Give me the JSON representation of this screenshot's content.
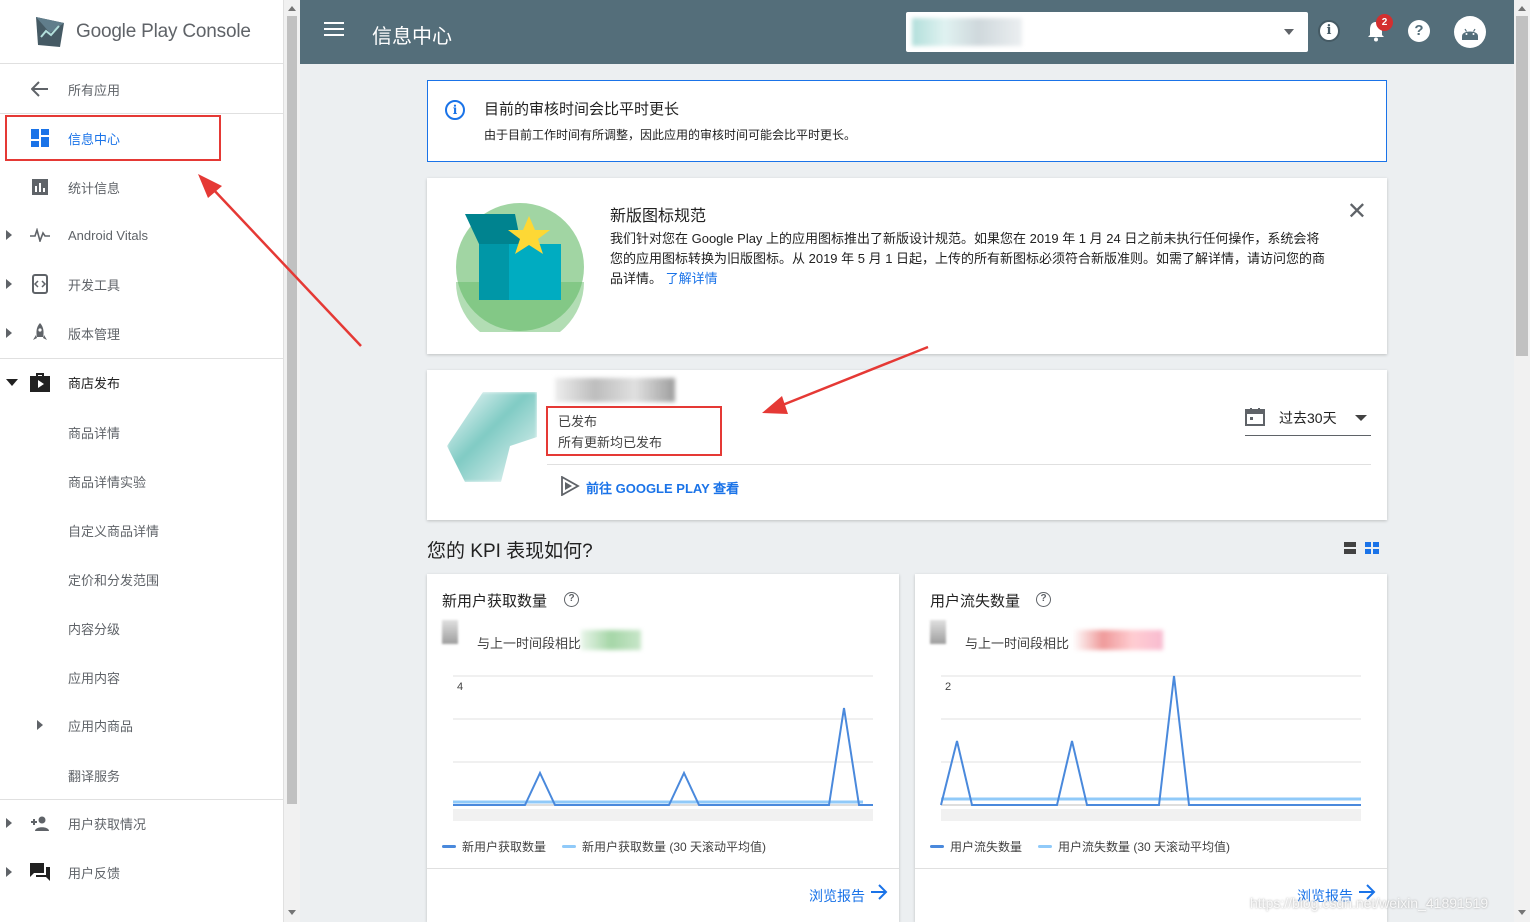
{
  "brand": {
    "name_a": "Google Play",
    "name_b": "Console"
  },
  "sidebar": {
    "items": [
      {
        "label": "所有应用"
      },
      {
        "label": "信息中心"
      },
      {
        "label": "统计信息"
      },
      {
        "label": "Android Vitals"
      },
      {
        "label": "开发工具"
      },
      {
        "label": "版本管理"
      },
      {
        "label": "商店发布"
      },
      {
        "label": "商品详情"
      },
      {
        "label": "商品详情实验"
      },
      {
        "label": "自定义商品详情"
      },
      {
        "label": "定价和分发范围"
      },
      {
        "label": "内容分级"
      },
      {
        "label": "应用内容"
      },
      {
        "label": "应用内商品"
      },
      {
        "label": "翻译服务"
      },
      {
        "label": "用户获取情况"
      },
      {
        "label": "用户反馈"
      }
    ]
  },
  "topbar": {
    "title": "信息中心",
    "notification_count": "2",
    "info_glyph": "i",
    "help_glyph": "?"
  },
  "alert": {
    "title": "目前的审核时间会比平时更长",
    "body": "由于目前工作时间有所调整，因此应用的审核时间可能会比平时更长。",
    "glyph": "i"
  },
  "icon_notice": {
    "title": "新版图标规范",
    "body": "我们针对您在 Google Play 上的应用图标推出了新版设计规范。如果您在 2019 年 1 月 24 日之前未执行任何操作，系统会将您的应用图标转换为旧版图标。从 2019 年 5 月 1 日起，上传的所有新图标必须符合新版准则。如需了解详情，请访问您的商品详情。",
    "link": "了解详情",
    "close_glyph": "✕"
  },
  "app_status": {
    "status": "已发布",
    "substatus": "所有更新均已发布",
    "play_link": "前往 GOOGLE PLAY 查看",
    "date_range": "过去30天"
  },
  "kpi_heading": "您的 KPI 表现如何?",
  "kpis": [
    {
      "title": "新用户获取数量",
      "compare_label": "与上一时间段相比",
      "legend_a": "新用户获取数量",
      "legend_b": "新用户获取数量 (30 天滚动平均值)",
      "report_link": "浏览报告",
      "y_tick": "4"
    },
    {
      "title": "用户流失数量",
      "compare_label": "与上一时间段相比",
      "legend_a": "用户流失数量",
      "legend_b": "用户流失数量 (30 天滚动平均值)",
      "report_link": "浏览报告",
      "y_tick": "2"
    }
  ],
  "watermark": "https://blog.csdn.net/weixin_41891519",
  "colors": {
    "topbar": "#546e7a",
    "accent": "#1a73e8",
    "annotation_red": "#e53935",
    "series_main": "#4a89dc",
    "series_avg": "#90caf9"
  },
  "icons": [
    "menu-icon",
    "info-icon",
    "bell-icon",
    "help-icon",
    "android-avatar-icon",
    "arrow-back-icon",
    "dashboard-icon",
    "bar-chart-icon",
    "vitals-icon",
    "dev-tools-icon",
    "rocket-icon",
    "store-icon",
    "acquisition-icon",
    "feedback-icon",
    "calendar-icon",
    "play-icon",
    "close-icon",
    "arrow-forward-icon"
  ]
}
